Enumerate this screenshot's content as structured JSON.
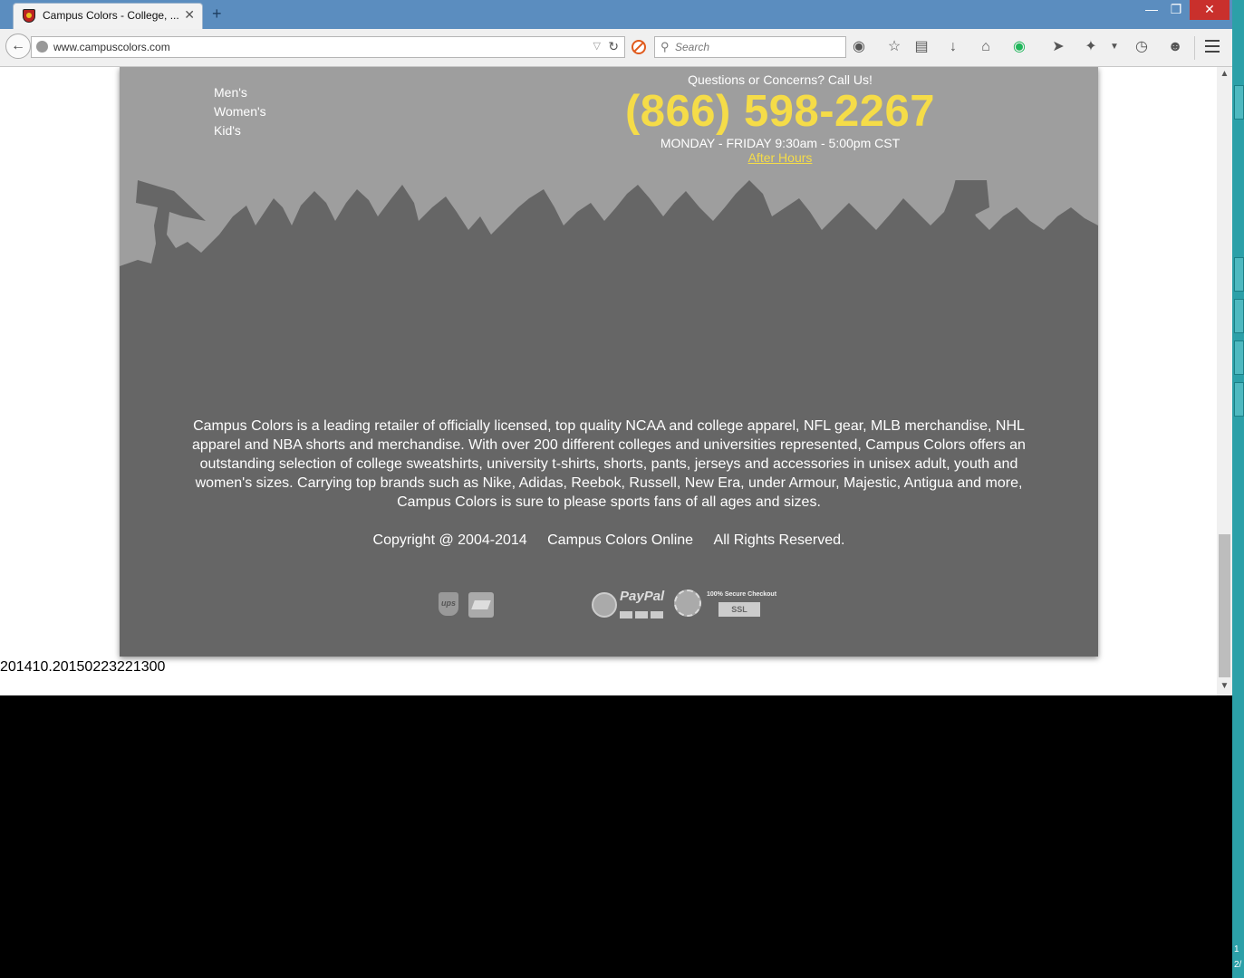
{
  "browser": {
    "tab_title": "Campus Colors - College, ...",
    "tab_close": "✕",
    "new_tab": "+",
    "window_controls": {
      "minimize": "—",
      "maximize": "❐",
      "close": "✕"
    },
    "url": "www.campuscolors.com",
    "search_placeholder": "Search",
    "toolbar_icons": [
      "globe-icon",
      "bookmark-star-icon",
      "reading-list-icon",
      "download-icon",
      "home-icon",
      "grammarly-icon",
      "send-icon",
      "extension-icon",
      "history-icon",
      "chat-icon",
      "menu-icon"
    ]
  },
  "footer": {
    "menu": [
      "Men's",
      "Women's",
      "Kid's"
    ],
    "contact": {
      "prompt": "Questions or Concerns? Call Us!",
      "phone": "(866) 598-2267",
      "hours": "MONDAY - FRIDAY 9:30am - 5:00pm CST",
      "after_hours_link": "After Hours"
    },
    "description": "Campus Colors is a leading retailer of officially licensed, top quality NCAA and college apparel, NFL gear, MLB merchandise, NHL apparel and NBA shorts and merchandise. With over 200 different colleges and universities represented, Campus Colors offers an outstanding selection of college sweatshirts, university t-shirts, shorts, pants, jerseys and accessories in unisex adult, youth and women's sizes. Carrying top brands such as Nike, Adidas, Reebok, Russell, New Era, under Armour, Majestic, Antigua and more, Campus Colors is sure to please sports fans of all ages and sizes.",
    "copyright": {
      "years": "Copyright @ 2004-2014",
      "company": "Campus Colors Online",
      "rights": "All Rights Reserved."
    },
    "badges": {
      "ups": "ups",
      "paypal": "PayPal",
      "secure": "100% Secure Checkout",
      "ssl": "SSL"
    },
    "colors": {
      "phone": "#f5dc48",
      "footer_top": "#9e9e9e",
      "footer_bottom": "#666666"
    }
  },
  "build_id": "201410.20150223221300",
  "taskbar": {
    "time_partial": "1",
    "date_partial": "2/"
  }
}
